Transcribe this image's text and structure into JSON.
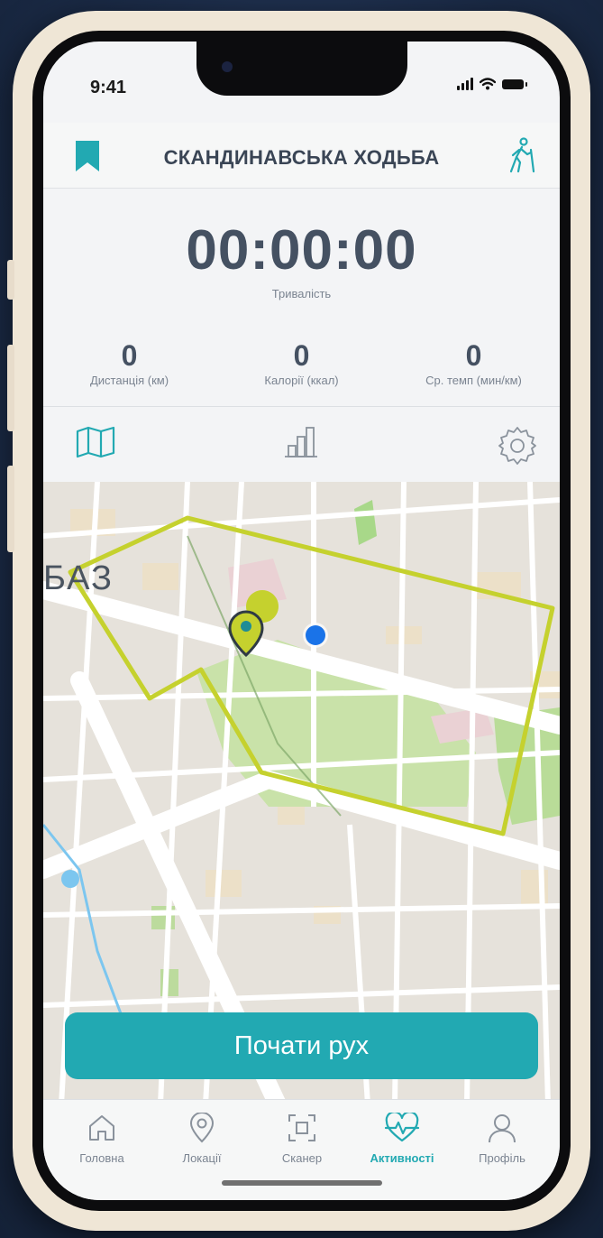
{
  "status_bar": {
    "time": "9:41"
  },
  "header": {
    "title": "СКАНДИНАВСЬКА ХОДЬБА",
    "left_icon": "bookmark-icon",
    "right_icon": "nordic-walking-icon"
  },
  "timer": {
    "value": "00:00:00",
    "label": "Тривалість"
  },
  "stats": [
    {
      "value": "0",
      "label": "Дистанція (км)"
    },
    {
      "value": "0",
      "label": "Калорії (ккал)"
    },
    {
      "value": "0",
      "label": "Ср. темп (мин/км)"
    }
  ],
  "tabs": [
    {
      "icon": "map-icon",
      "active": true
    },
    {
      "icon": "bar-chart-icon",
      "active": false
    },
    {
      "icon": "gear-icon",
      "active": false
    }
  ],
  "map": {
    "label": "БАЗ",
    "route_color": "#c5d12e",
    "location_color": "#1a73e8"
  },
  "start_button": {
    "label": "Почати рух"
  },
  "nav": [
    {
      "label": "Головна",
      "icon": "home-icon",
      "active": false
    },
    {
      "label": "Локації",
      "icon": "location-pin-icon",
      "active": false
    },
    {
      "label": "Сканер",
      "icon": "scanner-icon",
      "active": false
    },
    {
      "label": "Активності",
      "icon": "heart-pulse-icon",
      "active": true
    },
    {
      "label": "Профіль",
      "icon": "user-icon",
      "active": false
    }
  ],
  "colors": {
    "accent": "#22a9b2",
    "text_primary": "#455162",
    "text_secondary": "#7b8491"
  }
}
